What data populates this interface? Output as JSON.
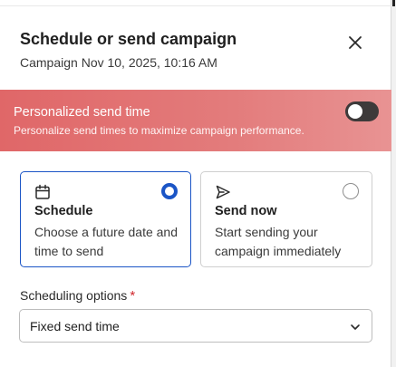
{
  "dialog": {
    "title": "Schedule or send campaign",
    "subtitle": "Campaign Nov 10, 2025, 10:16 AM",
    "close_icon": "close-icon"
  },
  "banner": {
    "title": "Personalized send time",
    "description": "Personalize send times to maximize campaign performance.",
    "toggle_on": false,
    "colors": {
      "start": "#e06768",
      "end": "#e89393"
    }
  },
  "options": [
    {
      "icon": "calendar-icon",
      "title": "Schedule",
      "description": "Choose a future date and time to send",
      "selected": true
    },
    {
      "icon": "send-icon",
      "title": "Send now",
      "description": "Start sending your campaign immediately",
      "selected": false
    }
  ],
  "scheduling": {
    "label": "Scheduling options",
    "required_mark": "*",
    "value": "Fixed send time"
  },
  "accent": "#1b55c6"
}
